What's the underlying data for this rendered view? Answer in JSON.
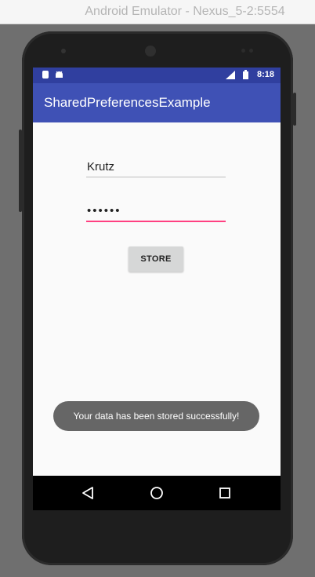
{
  "window": {
    "title": "Android Emulator - Nexus_5-2:5554"
  },
  "status_bar": {
    "time": "8:18",
    "icons": [
      "sd-card-icon",
      "android-icon",
      "signal-icon",
      "battery-icon"
    ]
  },
  "app_bar": {
    "title": "SharedPreferencesExample"
  },
  "form": {
    "username_value": "Krutz",
    "password_value": "••••••",
    "store_label": "STORE"
  },
  "toast": {
    "message": "Your data has been stored successfully!"
  },
  "nav": {
    "icons": [
      "back-icon",
      "home-icon",
      "recents-icon"
    ]
  },
  "colors": {
    "primary_dark": "#303f9f",
    "primary": "#3f51b5",
    "accent": "#ff4081",
    "toast_bg": "#666666"
  }
}
